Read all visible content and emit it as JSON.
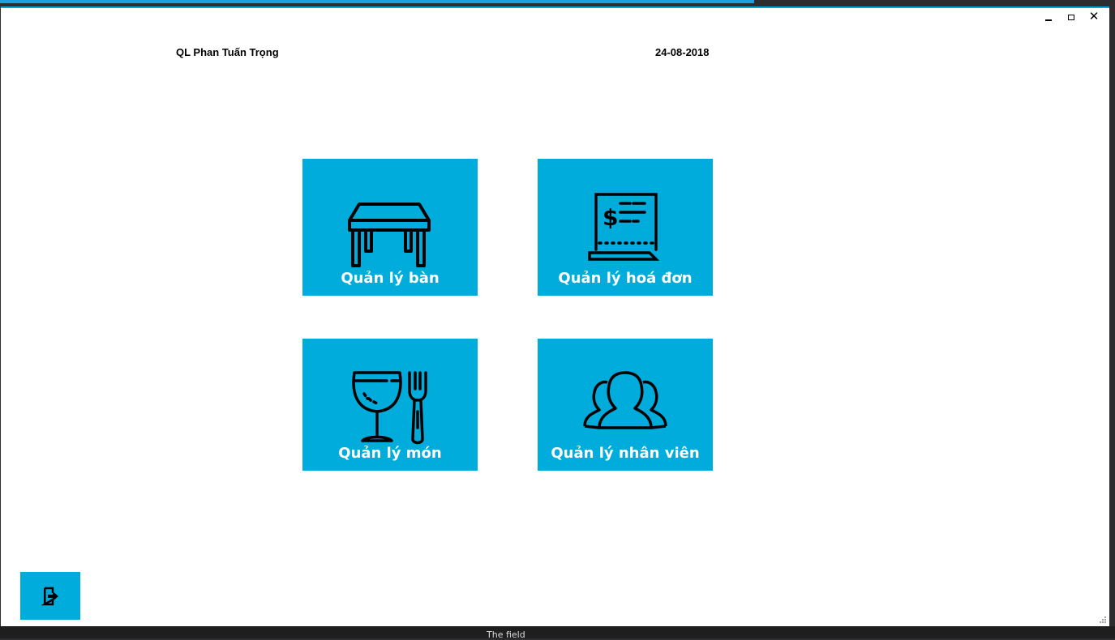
{
  "window": {
    "controls": {
      "minimize_icon": "minimize-icon",
      "maximize_icon": "maximize-icon",
      "close_icon": "close-icon"
    }
  },
  "header": {
    "manager_name": "QL Phan Tuấn Trọng",
    "date": "24-08-2018"
  },
  "tiles": [
    {
      "label": "Quản lý bàn",
      "icon": "table-icon"
    },
    {
      "label": "Quản lý hoá đơn",
      "icon": "receipt-icon"
    },
    {
      "label": "Quản lý món",
      "icon": "glass-fork-icon"
    },
    {
      "label": "Quản lý nhân viên",
      "icon": "people-icon"
    }
  ],
  "logout": {
    "icon": "exit-icon"
  },
  "background": {
    "status_text": "The field"
  },
  "colors": {
    "tile_bg": "#00acdc",
    "tile_text": "#ffffff",
    "window_border": "#00aadd"
  }
}
